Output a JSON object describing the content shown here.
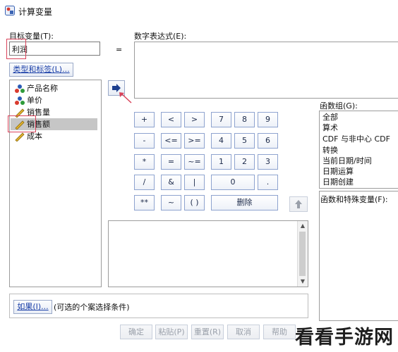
{
  "window": {
    "title": "计算变量"
  },
  "target": {
    "label": "目标变量(T):",
    "value": "利润",
    "type_label_button": "类型和标签(L)..."
  },
  "equals": "=",
  "expression": {
    "label": "数字表达式(E):"
  },
  "variables": [
    {
      "name": "产品名称",
      "icon": "nominal-icon"
    },
    {
      "name": "单价",
      "icon": "nominal-icon"
    },
    {
      "name": "销售量",
      "icon": "scale-icon"
    },
    {
      "name": "销售额",
      "icon": "scale-icon",
      "selected": true
    },
    {
      "name": "成本",
      "icon": "scale-icon"
    }
  ],
  "keypad": [
    [
      "+",
      "<",
      ">",
      "7",
      "8",
      "9"
    ],
    [
      "-",
      "<=",
      ">=",
      "4",
      "5",
      "6"
    ],
    [
      "*",
      "=",
      "~=",
      "1",
      "2",
      "3"
    ],
    [
      "/",
      "&",
      "|",
      "0",
      "."
    ],
    [
      "**",
      "~",
      "( )",
      "删除"
    ]
  ],
  "function_group": {
    "label": "函数组(G):",
    "items": [
      "全部",
      "算术",
      "CDF 与非中心 CDF",
      "转换",
      "当前日期/时间",
      "日期运算",
      "日期创建"
    ]
  },
  "functions_label": "函数和特殊变量(F):",
  "if_button": "如果(I)...",
  "if_hint": "(可选的个案选择条件)",
  "footer_buttons": [
    "确定",
    "粘贴(P)",
    "重置(R)",
    "取消",
    "帮助"
  ],
  "watermark": "看看手游网",
  "colors": {
    "highlight_red": "#d9435a",
    "selection": "#c6c6c6",
    "link": "#1a3fa8"
  }
}
